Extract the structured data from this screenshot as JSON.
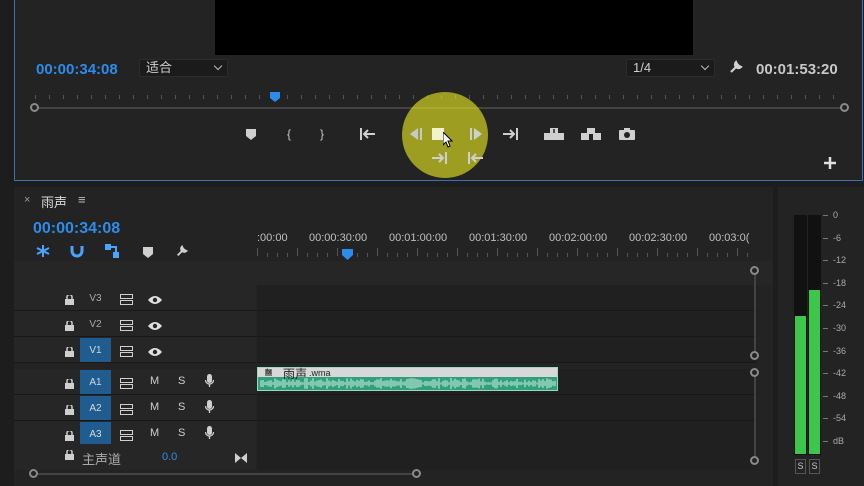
{
  "monitor": {
    "current_time": "00:00:34:08",
    "fit_select": "适合",
    "resolution_select": "1/4",
    "duration": "00:01:53:20",
    "playhead_fraction": 0.296
  },
  "timeline": {
    "sequence_name": "雨声",
    "current_time": "00:00:34:08",
    "ruler_labels": [
      ":00:00",
      "00:00:30:00",
      "00:01:00:00",
      "00:01:30:00",
      "00:02:00:00",
      "00:02:30:00",
      "00:03:0("
    ],
    "tracks": [
      {
        "name": "V3",
        "kind": "video",
        "selected": false
      },
      {
        "name": "V2",
        "kind": "video",
        "selected": false
      },
      {
        "name": "V1",
        "kind": "video",
        "selected": true
      },
      {
        "name": "A1",
        "kind": "audio",
        "selected": true
      },
      {
        "name": "A2",
        "kind": "audio",
        "selected": true
      },
      {
        "name": "A3",
        "kind": "audio",
        "selected": true
      }
    ],
    "mute_label": "M",
    "solo_label": "S",
    "master": {
      "label": "主声道",
      "value": "0.0"
    },
    "clip": {
      "fx_badge": "fx",
      "name": "雨声",
      "ext": ".wma"
    }
  },
  "meter": {
    "scale": [
      "0",
      "-6",
      "-12",
      "-18",
      "-24",
      "-30",
      "-36",
      "-42",
      "-48",
      "-54",
      "dB"
    ],
    "left_level": 0.58,
    "right_level": 0.69,
    "solo_labels": [
      "S",
      "S"
    ]
  },
  "colors": {
    "accent": "#2d8ceb",
    "selected_track": "#1f5d91",
    "clip": "#2f9f7c",
    "meter": "#3bc84a",
    "highlight": "#dee020"
  }
}
